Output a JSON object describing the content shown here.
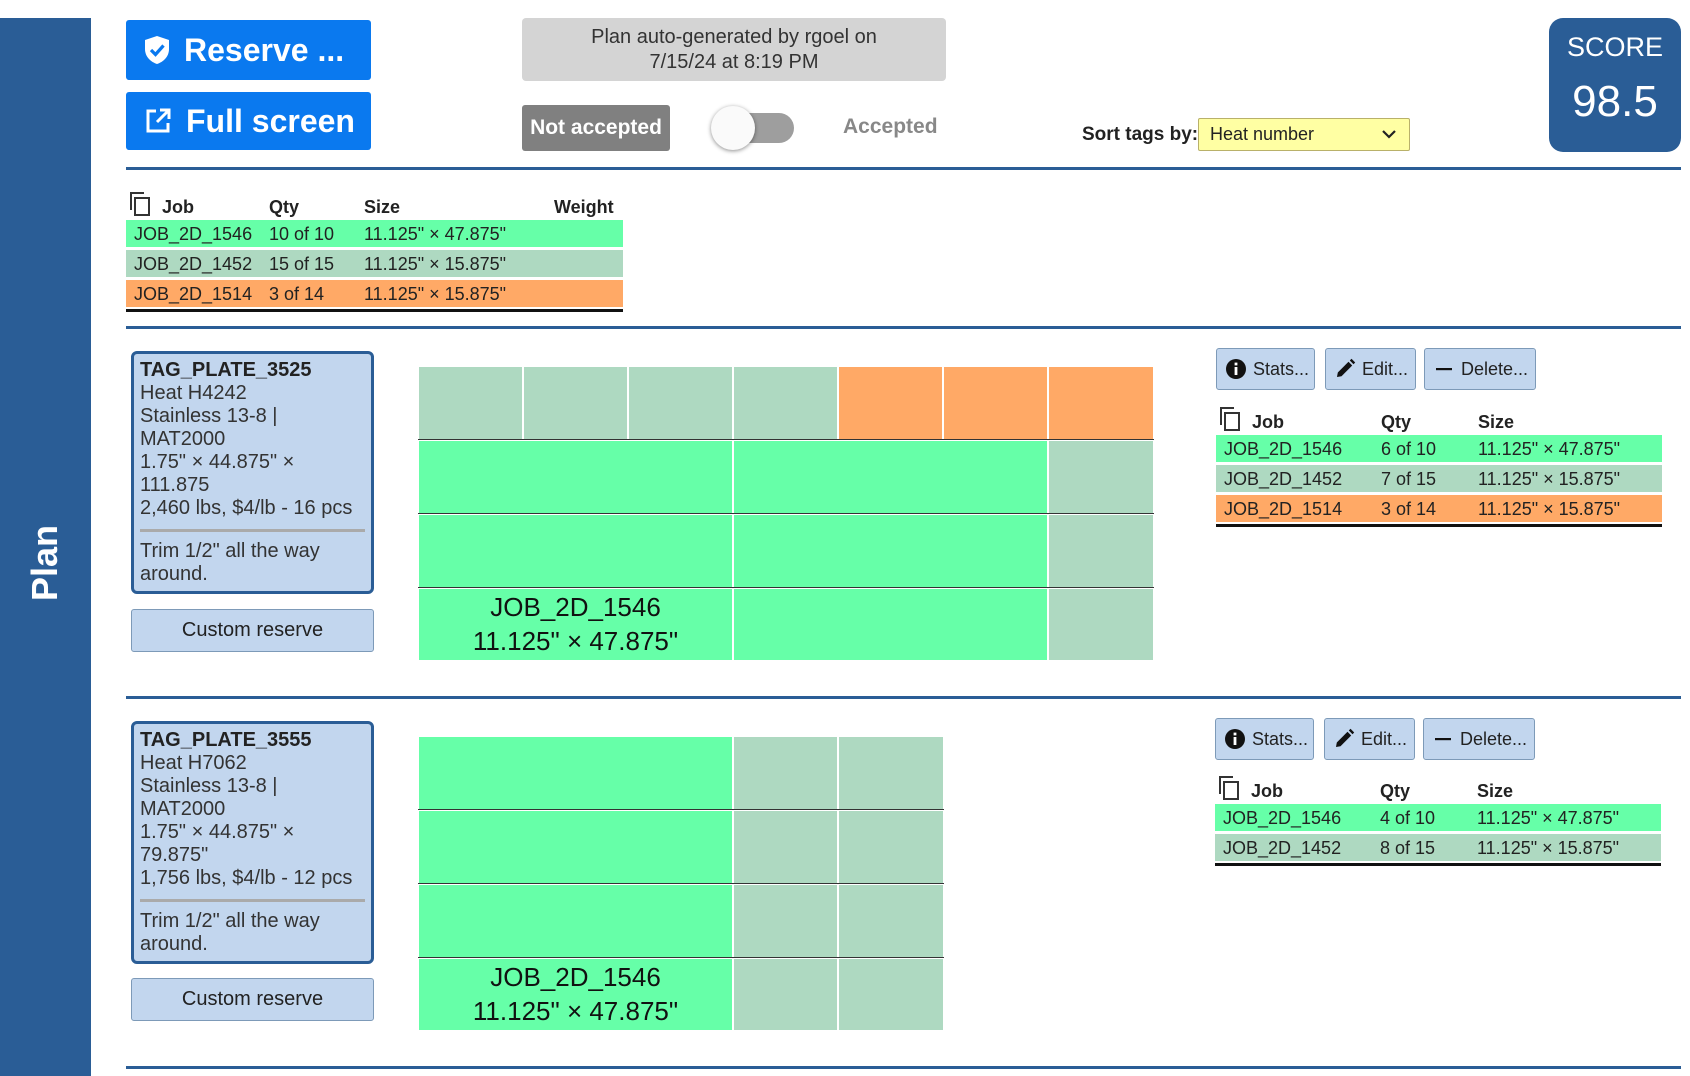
{
  "sidebar": {
    "label": "Plan"
  },
  "toolbar": {
    "reserve_label": "Reserve ...",
    "fullscreen_label": "Full screen"
  },
  "banner": {
    "line1": "Plan auto-generated by rgoel on",
    "line2": "7/15/24 at 8:19 PM"
  },
  "acceptance": {
    "not_accepted_label": "Not accepted",
    "accepted_label": "Accepted",
    "accepted": false
  },
  "sort": {
    "label": "Sort tags by:",
    "selected": "Heat number"
  },
  "score": {
    "label": "SCORE",
    "value": "98.5"
  },
  "summary": {
    "headers": {
      "job": "Job",
      "qty": "Qty",
      "size": "Size",
      "weight": "Weight"
    },
    "rows": [
      {
        "job": "JOB_2D_1546",
        "qty": "10 of 10",
        "size": "11.125\" × 47.875\"",
        "color": "green"
      },
      {
        "job": "JOB_2D_1452",
        "qty": "15 of 15",
        "size": "11.125\" × 15.875\"",
        "color": "sage"
      },
      {
        "job": "JOB_2D_1514",
        "qty": "3 of 14",
        "size": "11.125\" × 15.875\"",
        "color": "orange"
      }
    ]
  },
  "plates": [
    {
      "tag": "TAG_PLATE_3525",
      "heat": "Heat H4242",
      "material": "Stainless 13-8 | MAT2000",
      "dims": "1.75\" × 44.875\" × 111.875",
      "weight_price": "2,460 lbs, $4/lb - 16 pcs",
      "note_line1": "Trim 1/2\" all the way",
      "note_line2": "around.",
      "custom_reserve": "Custom reserve",
      "nest_label_line1": "JOB_2D_1546",
      "nest_label_line2": "11.125\" × 47.875\"",
      "buttons": {
        "stats": "Stats...",
        "edit": "Edit...",
        "delete": "Delete..."
      },
      "table": {
        "headers": {
          "job": "Job",
          "qty": "Qty",
          "size": "Size"
        },
        "rows": [
          {
            "job": "JOB_2D_1546",
            "qty": "6 of 10",
            "size": "11.125\" × 47.875\"",
            "color": "green"
          },
          {
            "job": "JOB_2D_1452",
            "qty": "7 of 15",
            "size": "11.125\" × 15.875\"",
            "color": "sage"
          },
          {
            "job": "JOB_2D_1514",
            "qty": "3 of 14",
            "size": "11.125\" × 15.875\"",
            "color": "orange"
          }
        ]
      }
    },
    {
      "tag": "TAG_PLATE_3555",
      "heat": "Heat H7062",
      "material": "Stainless 13-8 | MAT2000",
      "dims": "1.75\" × 44.875\" × 79.875\"",
      "weight_price": "1,756 lbs, $4/lb - 12 pcs",
      "note_line1": "Trim 1/2\" all the way",
      "note_line2": "around.",
      "custom_reserve": "Custom reserve",
      "nest_label_line1": "JOB_2D_1546",
      "nest_label_line2": "11.125\" × 47.875\"",
      "buttons": {
        "stats": "Stats...",
        "edit": "Edit...",
        "delete": "Delete..."
      },
      "table": {
        "headers": {
          "job": "Job",
          "qty": "Qty",
          "size": "Size"
        },
        "rows": [
          {
            "job": "JOB_2D_1546",
            "qty": "4 of 10",
            "size": "11.125\" × 47.875\"",
            "color": "green"
          },
          {
            "job": "JOB_2D_1452",
            "qty": "8 of 15",
            "size": "11.125\" × 15.875\"",
            "color": "sage"
          }
        ]
      }
    }
  ],
  "colors": {
    "brand": "#2a5d96",
    "button": "#0a79ef",
    "job_green": "#66ffa8",
    "job_sage": "#aed9c1",
    "job_orange": "#ffa966",
    "select_bg": "#ffffa3"
  }
}
